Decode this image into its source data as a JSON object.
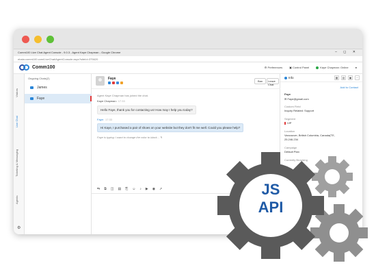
{
  "window": {
    "title": "Comm100 Live Chat Agent Console - 9.0.3 - Agent Kaye Chapman - Google Chrome",
    "url": "ebala.comm100.com/LiveChat/AgentConsole.aspx?siteId=375620",
    "controls": "–  ◻  ✕"
  },
  "header": {
    "brand": "Comm100",
    "preferences": "Preferences",
    "control_panel": "Control Panel",
    "agent_status": "Kaye Chapman: Online"
  },
  "side_tabs": {
    "visitors": "Visitors",
    "live_chat": "Live Chat",
    "ticketing": "Ticketing & Messaging",
    "agents": "Agents"
  },
  "chat_list": {
    "section_label": "Ongoing Chats(2)",
    "items": [
      {
        "name": "James"
      },
      {
        "name": "Faye"
      }
    ]
  },
  "conversation": {
    "visitor_name": "Faye",
    "ban_label": "Ban",
    "leave_label": "Leave Chat",
    "system_message": "Agent Kaye Chapman has joined the chat.",
    "agent_name": "Kaye Chapman:",
    "agent_time": "17:33",
    "agent_message": "Hello Faye, thank you for contacting us! How may I help you today?",
    "visitor_label": "Faye:",
    "visitor_time": "17:33",
    "visitor_message": "Hi Kaye, I purchased a pair of shoes on your website but they don't fit me well. Could you please help?",
    "typing": "Faye is typing: I want to change the color to black..."
  },
  "info": {
    "tab_label": "Info",
    "add_contact": "Add to Contact",
    "name": "Faye",
    "email": "Faye@gmail.com",
    "custom_field_label": "Custom Field",
    "custom_field_value": "Inquiry Related: Support",
    "segment_label": "Segment",
    "segment_value": "VIP",
    "location_label": "Location",
    "location_value": "Vancouver, British Columbia, Canada(TE,",
    "location_ip": "25.246.234",
    "campaign_label": "Campaign",
    "campaign_value": "Default Plan",
    "browsing_label": "Currently Browsing"
  },
  "badge": {
    "line1": "JS",
    "line2": "API"
  },
  "colors": {
    "accent": "#2b86d8",
    "badge_text": "#1f5aa6",
    "gear_dark": "#5a5a5a",
    "gear_light": "#9a9a9a"
  }
}
